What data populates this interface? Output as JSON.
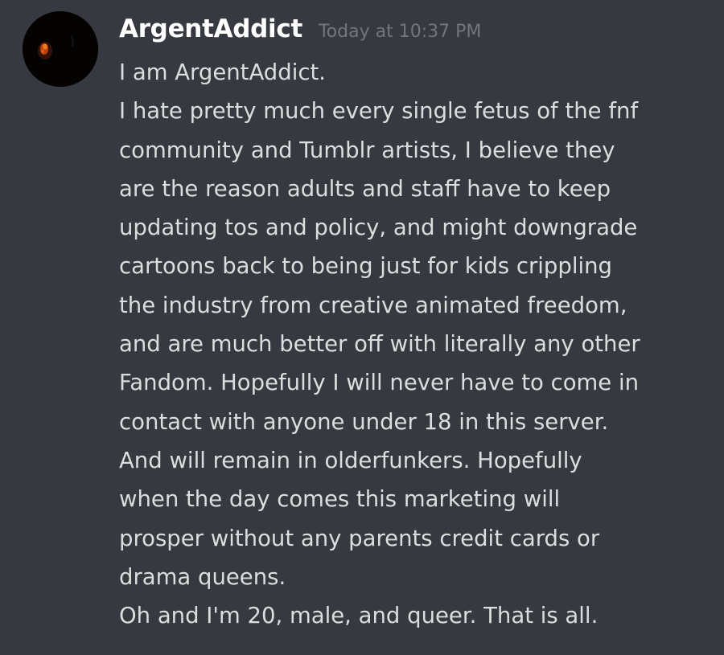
{
  "message": {
    "author": "ArgentAddict",
    "timestamp": "Today at 10:37 PM",
    "lines": [
      "I am ArgentAddict.",
      "I hate pretty much every single fetus of the fnf",
      "community and Tumblr artists, I believe they",
      "are the reason adults and staff have to keep",
      "updating tos and policy, and might downgrade",
      "cartoons back to being just for kids crippling",
      "the industry from creative animated freedom,",
      "and are much better off with literally any other",
      "Fandom. Hopefully I will never have to come in",
      "contact with anyone under 18 in this server.",
      "And will remain in olderfunkers. Hopefully",
      "when the day comes this marketing will",
      "prosper without any parents credit cards or",
      "drama queens.",
      "Oh and I'm 20, male, and queer. That is all."
    ]
  },
  "colors": {
    "background": "#36393f",
    "username": "#ffffff",
    "timestamp": "#72767d",
    "text": "#dcddde"
  }
}
